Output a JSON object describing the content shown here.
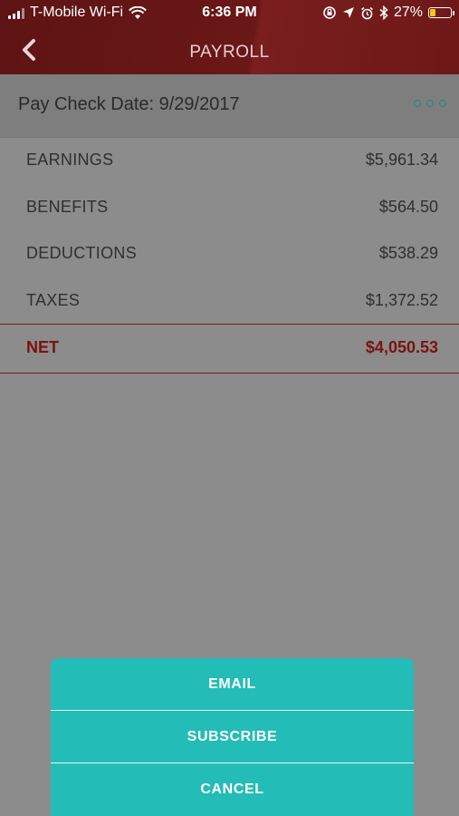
{
  "status_bar": {
    "carrier": "T-Mobile Wi-Fi",
    "time": "6:36 PM",
    "battery_percent_label": "27%",
    "battery_level": 0.27,
    "battery_color": "#f5c518",
    "icons": [
      "wifi-icon",
      "screen-lock-icon",
      "location-icon",
      "alarm-icon",
      "bluetooth-icon",
      "battery-icon"
    ]
  },
  "nav": {
    "title": "PAYROLL",
    "back_icon": "chevron-left-icon"
  },
  "pay_check": {
    "date_label": "Pay Check Date: 9/29/2017",
    "more_icon": "more-dots-icon"
  },
  "summary": {
    "rows": [
      {
        "label": "EARNINGS",
        "value": "$5,961.34"
      },
      {
        "label": "BENEFITS",
        "value": "$564.50"
      },
      {
        "label": "DEDUCTIONS",
        "value": "$538.29"
      },
      {
        "label": "TAXES",
        "value": "$1,372.52"
      }
    ],
    "net": {
      "label": "NET",
      "value": "$4,050.53"
    }
  },
  "action_sheet": {
    "email": "EMAIL",
    "subscribe": "SUBSCRIBE",
    "cancel": "CANCEL"
  },
  "colors": {
    "header": "#6a1717",
    "net_accent": "#7a1212",
    "sheet": "#23bcb7",
    "overlay": "#8c8c8c"
  }
}
